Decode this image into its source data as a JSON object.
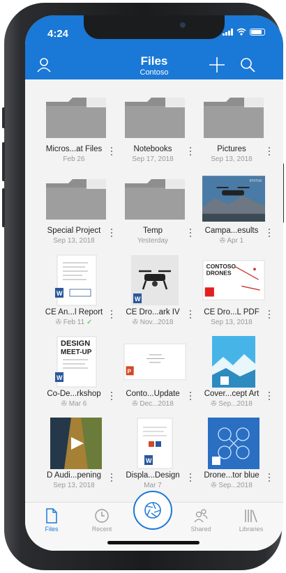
{
  "status": {
    "time": "4:24"
  },
  "header": {
    "title": "Files",
    "subtitle": "Contoso"
  },
  "files": [
    {
      "name": "Micros...at Files",
      "meta": "Feb 26",
      "kind": "folder"
    },
    {
      "name": "Notebooks",
      "meta": "Sep 17, 2018",
      "kind": "folder"
    },
    {
      "name": "Pictures",
      "meta": "Sep 13, 2018",
      "kind": "folder"
    },
    {
      "name": "Special Project",
      "meta": "Sep 13, 2018",
      "kind": "folder"
    },
    {
      "name": "Temp",
      "meta": "Yesterday",
      "kind": "folder"
    },
    {
      "name": "Campa...esults",
      "meta": "Apr 1",
      "kind": "drone-photo",
      "shared": true
    },
    {
      "name": "CE An...l Report",
      "meta": "Feb 11",
      "kind": "word-doc",
      "shared": true,
      "synced": true
    },
    {
      "name": "CE Dro...ark IV",
      "meta": "Nov...2018",
      "kind": "drone-doc",
      "shared": true
    },
    {
      "name": "CE Dro...L PDF",
      "meta": "Sep 13, 2018",
      "kind": "pdf-doc"
    },
    {
      "name": "Co-De...rkshop",
      "meta": "Mar 6",
      "kind": "word-design",
      "shared": true
    },
    {
      "name": "Conto...Update",
      "meta": "Dec...2018",
      "kind": "ppt-doc",
      "shared": true
    },
    {
      "name": "Cover...cept Art",
      "meta": "Sep...2018",
      "kind": "art-image",
      "shared": true
    },
    {
      "name": "D Audi...pening",
      "meta": "Sep 13, 2018",
      "kind": "video"
    },
    {
      "name": "Displa...Design",
      "meta": "Mar 7",
      "kind": "word-small"
    },
    {
      "name": "Drone...tor blue",
      "meta": "Sep...2018",
      "kind": "blueprint",
      "shared": true
    }
  ],
  "tabs": {
    "files": "Files",
    "recent": "Recent",
    "shared": "Shared",
    "libraries": "Libraries"
  },
  "colors": {
    "accent": "#1a78d6",
    "folder": "#8e8e8e",
    "word": "#2b579a",
    "ppt": "#d24726",
    "pdf": "#e02020"
  },
  "icons": {
    "profile": "person-icon",
    "add": "plus-icon",
    "search": "search-icon",
    "camera": "camera-aperture-icon"
  }
}
